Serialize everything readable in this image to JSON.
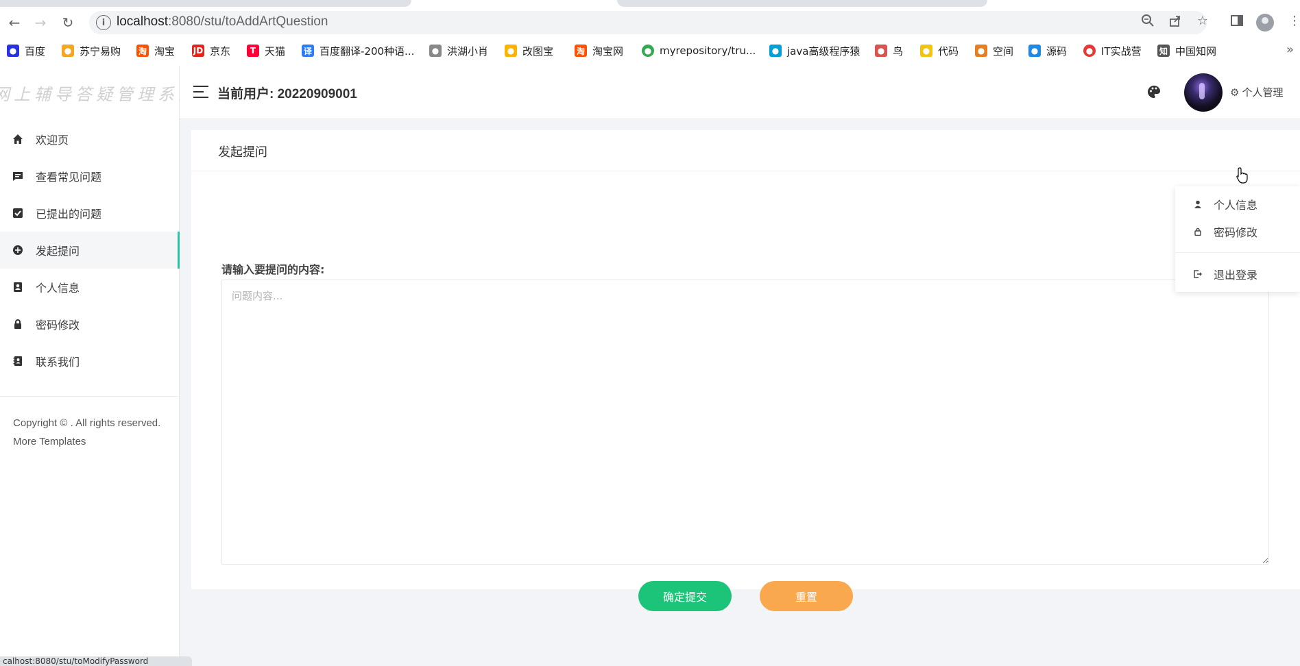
{
  "browser": {
    "url_host": "localhost",
    "url_rest": ":8080/stu/toAddArtQuestion",
    "bookmarks": [
      "百度",
      "苏宁易购",
      "淘宝",
      "京东",
      "天猫",
      "百度翻译-200种语...",
      "洪湖小肖",
      "改图宝",
      "淘宝网",
      "myrepository/tru...",
      "java高级程序猿",
      "鸟",
      "代码",
      "空间",
      "源码",
      "IT实战营",
      "中国知网"
    ],
    "bookmark_colors": [
      "#2932e1",
      "#f5a623",
      "#ff5000",
      "#e1251b",
      "#ff0036",
      "#2b7cf6",
      "#888888",
      "#ffb300",
      "#ff5000",
      "#34a853",
      "#00a1d6",
      "#d9534f",
      "#f1c40f",
      "#e67e22",
      "#1e88e5",
      "#e53935",
      "#555555"
    ],
    "status_text": "calhost:8080/stu/toModifyPassword"
  },
  "sidebar": {
    "logo": "网上辅导答疑管理系统",
    "items": [
      {
        "label": "欢迎页",
        "icon": "home-icon"
      },
      {
        "label": "查看常见问题",
        "icon": "comment-icon"
      },
      {
        "label": "已提出的问题",
        "icon": "check-square-icon"
      },
      {
        "label": "发起提问",
        "icon": "plus-circle-icon",
        "active": true
      },
      {
        "label": "个人信息",
        "icon": "contact-card-icon"
      },
      {
        "label": "密码修改",
        "icon": "lock-icon"
      },
      {
        "label": "联系我们",
        "icon": "address-book-icon"
      }
    ],
    "copyright": "Copyright © . All rights reserved. More Templates"
  },
  "header": {
    "current_user": "当前用户: 20220909001",
    "management": "个人管理"
  },
  "main": {
    "title": "发起提问",
    "label": "请输入要提问的内容:",
    "placeholder": "问题内容...",
    "value": "",
    "submit": "确定提交",
    "reset": "重置"
  },
  "dropdown": {
    "items": [
      {
        "label": "个人信息",
        "icon": "user-icon"
      },
      {
        "label": "密码修改",
        "icon": "lock-icon"
      },
      {
        "label": "退出登录",
        "icon": "logout-icon"
      }
    ]
  },
  "colors": {
    "accent": "#2bc4a4",
    "submit": "#1cc479",
    "reset": "#f9a84d"
  }
}
